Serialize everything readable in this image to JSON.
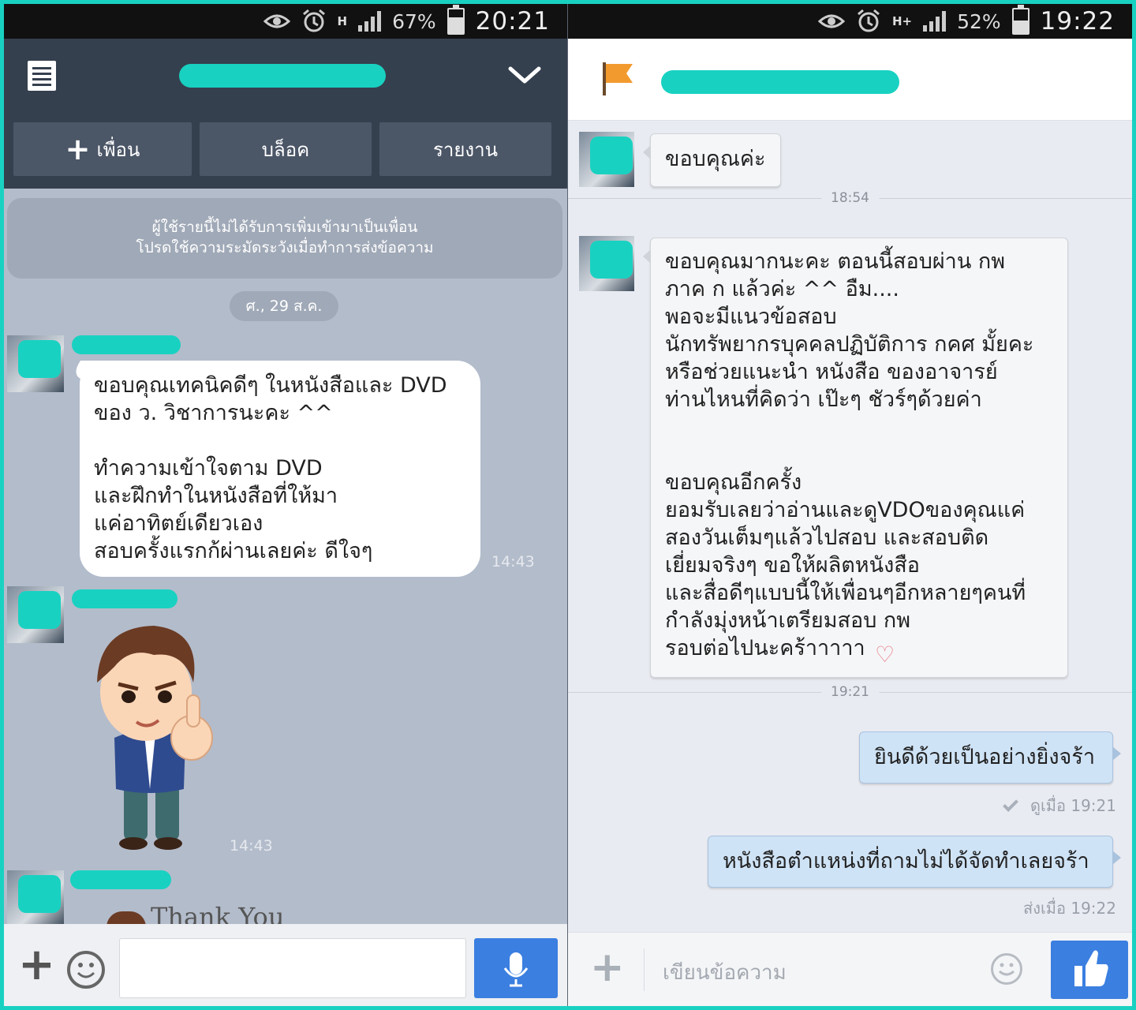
{
  "left": {
    "statusbar": {
      "network": "H",
      "signal_percent": "67%",
      "battery_level": 0.67,
      "time": "20:21"
    },
    "header": {
      "title_redacted": "",
      "actions": [
        {
          "label": "เพื่อน",
          "icon": "plus-icon"
        },
        {
          "label": "บล็อค"
        },
        {
          "label": "รายงาน"
        }
      ]
    },
    "warning": {
      "line1": "ผู้ใช้รายนี้ไม่ได้รับการเพิ่มเข้ามาเป็นเพื่อน",
      "line2": "โปรดใช้ความระมัดระวังเมื่อทำการส่งข้อความ"
    },
    "date_chip": "ศ., 29 ส.ค.",
    "messages": [
      {
        "text": "ขอบคุณเทคนิคดีๆ ในหนังสือและ DVD\nของ ว. วิชาการนะคะ ^^\n\nทำความเข้าใจตาม DVD\nและฝึกทำในหนังสือที่ให้มา\nแค่อาทิตย์เดียวเอง\nสอบครั้งแรกก้ผ่านเลยค่ะ ดีใจๆ",
        "time": "14:43"
      },
      {
        "sticker": "thumbs-up-man-sticker",
        "time": "14:43"
      },
      {
        "sticker_text": "Thank You"
      }
    ],
    "input": {
      "placeholder": ""
    }
  },
  "right": {
    "statusbar": {
      "network": "H+",
      "signal_percent": "52%",
      "battery_level": 0.52,
      "time": "19:22"
    },
    "header": {
      "title_redacted": ""
    },
    "messages": [
      {
        "text": "ขอบคุณค่ะ"
      },
      {
        "separator": "18:54"
      },
      {
        "text": "ขอบคุณมากนะคะ    ตอนนี้สอบผ่าน กพ\nภาค ก  แล้วค่ะ  ^^    อืม....\nพอจะมีแนวข้อสอบ\nนักทรัพยากรบุคคลปฏิบัติการ กคศ   มั้ยคะ\nหรือช่วยแนะนำ หนังสือ ของอาจารย์\nท่านไหนที่คิดว่า  เป๊ะๆ ชัวร์ๆด้วยค่า\n\n\nขอบคุณอีกครั้ง\nยอมรับเลยว่าอ่านและดูVDOของคุณแค่\nสองวันเต็มๆแล้วไปสอบ และสอบติด\nเยี่ยมจริงๆ ขอให้ผลิตหนังสือ\nและสื่อดีๆแบบนี้ให้เพื่อนๆอีกหลายๆคนที่\nกำลังมุ่งหน้าเตรียมสอบ กพ\nรอบต่อไปนะคร้าาาาา"
      },
      {
        "separator": "19:21"
      },
      {
        "text": "ยินดีด้วยเป็นอย่างยิ่งจร้า",
        "meta": "ดูเมื่อ 19:21"
      },
      {
        "text": "หนังสือตำแหน่งที่ถามไม่ได้จัดทำเลยจร้า",
        "meta": "ส่งเมื่อ 19:22"
      }
    ],
    "input": {
      "placeholder": "เขียนข้อความ"
    }
  },
  "colors": {
    "redaction": "#19d1c1",
    "left_header": "#35404f",
    "send_blue": "#3b7fe0",
    "flag_orange": "#f39a2f"
  }
}
